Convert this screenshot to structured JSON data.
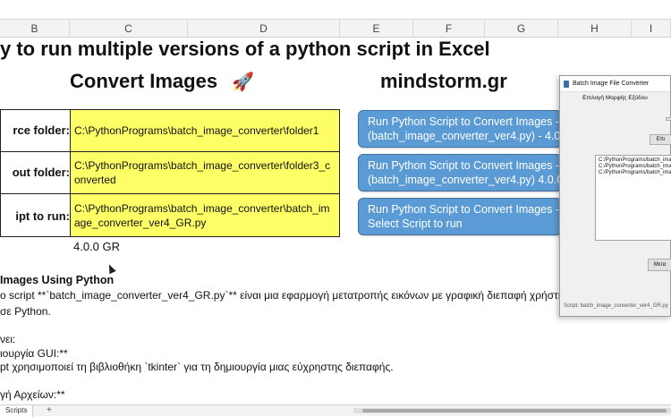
{
  "columns": [
    "B",
    "C",
    "D",
    "E",
    "F",
    "G",
    "H",
    "I"
  ],
  "sheet": {
    "title": "y to run multiple versions of a python script in Excel",
    "subtitle_left": "Convert Images",
    "rocket": "🚀",
    "subtitle_right": "mindstorm.gr"
  },
  "rows": [
    {
      "label": "rce folder:",
      "value": "C:\\PythonPrograms\\batch_image_converter\\folder1"
    },
    {
      "label": "out folder:",
      "value": "C:\\PythonPrograms\\batch_image_converter\\folder3_converted"
    },
    {
      "label": "ipt to run:",
      "value": "C:\\PythonPrograms\\batch_image_converter\\batch_image_converter_ver4_GR.py"
    }
  ],
  "version": "4.0.0 GR",
  "buttons": [
    {
      "line1": "Run Python Script to Convert Images - Ve",
      "line2": "(batch_image_converter_ver4.py) - 4.0.0"
    },
    {
      "line1": "Run Python Script to Convert Images - Ve",
      "line2": "(batch_image_converter_ver4.py) 4.0.0 EN"
    },
    {
      "line1": "Run Python Script to Convert Images - Ve",
      "line2": "Select Script to run"
    }
  ],
  "doc": {
    "heading": "Images Using Python",
    "line1": "ο script **`batch_image_converter_ver4_GR.py`** είναι μια εφαρμογή μετατροπής εικόνων με γραφική διεπαφή χρήστη",
    "line2": "σε Python.",
    "line3": "νει:",
    "line4": "ιουργία GUI:**",
    "line5": "pt χρησιμοποιεί τη βιβλιοθήκη `tkinter` για τη δημιουργία μιας εύχρηστης διεπαφής.",
    "line6": "γή Αρχείων:**"
  },
  "dialog": {
    "title": "Batch Image File Converter",
    "subtitle": "Επιλογή Μορφής Εξόδου",
    "select_btn": "Επι",
    "list": [
      "C:/PythonPrograms/batch_image_converter",
      "C:/PythonPrograms/batch_image_converter",
      "C:/PythonPrograms/batch_image_converter"
    ],
    "convert_btn": "Μετα",
    "status": "Script: batch_image_converter_ver4_GR.py"
  },
  "tabs": {
    "sheet": "Scripts",
    "add": "+"
  }
}
